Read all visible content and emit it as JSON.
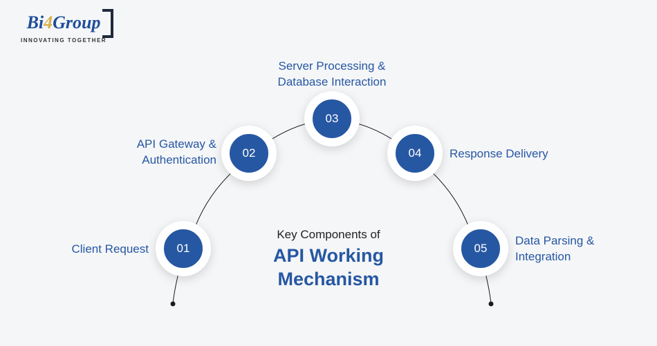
{
  "logo": {
    "brand_prefix": "Bi",
    "brand_digit": "4",
    "brand_suffix": "Group",
    "tagline": "INNOVATING TOGETHER"
  },
  "center": {
    "small": "Key Components of",
    "big": "API Working Mechanism"
  },
  "nodes": {
    "n1": {
      "num": "01",
      "label": "Client Request"
    },
    "n2": {
      "num": "02",
      "label": "API Gateway & Authentication"
    },
    "n3": {
      "num": "03",
      "label": "Server Processing & Database Interaction"
    },
    "n4": {
      "num": "04",
      "label": "Response Delivery"
    },
    "n5": {
      "num": "05",
      "label": "Data Parsing & Integration"
    }
  }
}
